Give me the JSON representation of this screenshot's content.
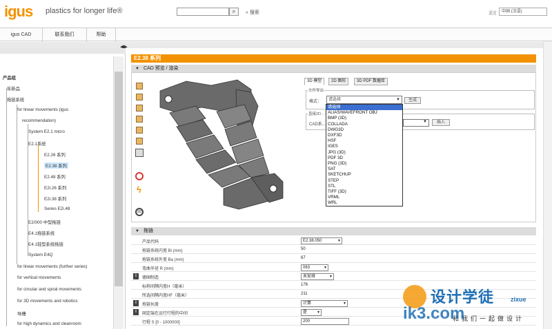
{
  "header": {
    "logo": "igus",
    "tagline": "plastics for longer life®",
    "search_button": "⌕",
    "search_label": "» 搜索",
    "lang_label": "语言",
    "lang_value": "中国 (汉语)"
  },
  "nav": {
    "tabs": [
      {
        "label": "igus CAD"
      },
      {
        "label": "联系我们"
      },
      {
        "label": "帮助"
      }
    ]
  },
  "sidebar": {
    "collapse": "◀▶",
    "tree": [
      {
        "label": "产品组"
      },
      {
        "label": "年新品"
      },
      {
        "label": "拖链系统"
      },
      {
        "label": "for linear movements (igus"
      },
      {
        "label": "recommendation)"
      },
      {
        "label": "System E2.1 micro"
      },
      {
        "label": "E2.1系统"
      },
      {
        "label": "E2.26 系列"
      },
      {
        "label": "E2.38 系列"
      },
      {
        "label": "E2.48 系列"
      },
      {
        "label": "E2i.26 系列"
      },
      {
        "label": "E2i.38 系列"
      },
      {
        "label": "Series E2i.48"
      },
      {
        "label": "E2/000 中型拖链"
      },
      {
        "label": "E4.1拖链系统"
      },
      {
        "label": "E4.1轻型系统拖链"
      },
      {
        "label": "System E4Q"
      },
      {
        "label": "for linear movements (further series)"
      },
      {
        "label": "for vertical movements"
      },
      {
        "label": "for circular and spiral movements"
      },
      {
        "label": "for 3D movements and robotics"
      },
      {
        "label": "导槽"
      },
      {
        "label": "for high dynamics and cleanroom"
      }
    ]
  },
  "main": {
    "title": "E2.38 系列",
    "cad_section": "CAD 预览 / 渲染",
    "tabs": [
      {
        "label": "3D 模型"
      },
      {
        "label": "2D 图形"
      },
      {
        "label": "3D PDF 数据库"
      }
    ],
    "file_legend": "文件导出",
    "format_label": "格式：",
    "format_value": "请选择",
    "generate": "生成",
    "cad_legend": "直接2D...",
    "cad_label": "CAD系...",
    "insert": "插入",
    "formats": [
      "请选择",
      "ALIAS/WAVEFRONT OBJ",
      "BMP (3D)",
      "COLLADA",
      "DWG3D",
      "DXF3D",
      "HSF",
      "IGES",
      "JPG (3D)",
      "PDF 3D",
      "PNG (3D)",
      "SAT",
      "SKETCHUP",
      "STEP",
      "STL",
      "TIFF (3D)",
      "VRML",
      "WRL"
    ],
    "params_section": "拖链",
    "params": [
      {
        "label": "产品代码",
        "value": "E2.38.050",
        "type": "select"
      },
      {
        "label": "拖链系统内宽 Bi (mm)",
        "value": "50",
        "type": "text"
      },
      {
        "label": "拖链系统外宽 Ba (mm)",
        "value": "67",
        "type": "text"
      },
      {
        "label": "弯曲半径 R (mm)",
        "value": "063",
        "type": "select"
      },
      {
        "label": "德国制造",
        "value": "未安排",
        "type": "select",
        "info": "i"
      },
      {
        "label": "标称间隔内宽H（毫米）",
        "value": "176",
        "type": "text"
      },
      {
        "label": "所选间隔内宽HF（毫米）",
        "value": "211",
        "type": "text"
      },
      {
        "label": "拖链长度",
        "value": "计算",
        "type": "select",
        "info": "i"
      },
      {
        "label": "固定端在运行行程的中间",
        "value": "是",
        "type": "select",
        "info": "i"
      },
      {
        "label": "行程 S [0 - 1000000]",
        "value": "200",
        "type": "input"
      }
    ]
  },
  "watermark": {
    "line1": "设计学徒",
    "line2": "zixue",
    "line3": "和我们一起做设计",
    "domain": "ik3.com"
  }
}
